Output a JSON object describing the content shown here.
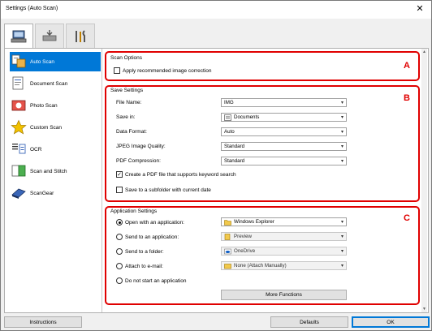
{
  "window": {
    "title": "Settings (Auto Scan)",
    "close_glyph": "✕"
  },
  "tabs": [
    {
      "icon": "computer-scan-icon"
    },
    {
      "icon": "scanner-tray-icon"
    },
    {
      "icon": "tools-icon"
    }
  ],
  "sidebar": {
    "items": [
      {
        "label": "Auto Scan",
        "icon": "auto-scan-icon",
        "active": true
      },
      {
        "label": "Document Scan",
        "icon": "document-scan-icon"
      },
      {
        "label": "Photo Scan",
        "icon": "photo-scan-icon"
      },
      {
        "label": "Custom Scan",
        "icon": "star-icon"
      },
      {
        "label": "OCR",
        "icon": "ocr-icon"
      },
      {
        "label": "Scan and Stitch",
        "icon": "stitch-icon"
      },
      {
        "label": "ScanGear",
        "icon": "scangear-icon"
      }
    ]
  },
  "scan_options": {
    "title": "Scan Options",
    "letter": "A",
    "apply_correction": {
      "label": "Apply recommended image correction",
      "checked": false
    }
  },
  "save_settings": {
    "title": "Save Settings",
    "letter": "B",
    "file_name": {
      "label": "File Name:",
      "value": "IMG"
    },
    "save_in": {
      "label": "Save in:",
      "value": "Documents"
    },
    "data_format": {
      "label": "Data Format:",
      "value": "Auto"
    },
    "jpeg_quality": {
      "label": "JPEG Image Quality:",
      "value": "Standard"
    },
    "pdf_compression": {
      "label": "PDF Compression:",
      "value": "Standard"
    },
    "keyword_search": {
      "label": "Create a PDF file that supports keyword search",
      "checked": true
    },
    "subfolder": {
      "label": "Save to a subfolder with current date",
      "checked": false
    }
  },
  "app_settings": {
    "title": "Application Settings",
    "letter": "C",
    "open_app": {
      "label": "Open with an application:",
      "value": "Windows Explorer",
      "selected": true
    },
    "send_app": {
      "label": "Send to an application:",
      "value": "Preview"
    },
    "send_folder": {
      "label": "Send to a folder:",
      "value": "OneDrive"
    },
    "attach_email": {
      "label": "Attach to e-mail:",
      "value": "None (Attach Manually)"
    },
    "do_not_start": {
      "label": "Do not start an application"
    },
    "more_functions": "More Functions"
  },
  "footer": {
    "instructions": "Instructions",
    "defaults": "Defaults",
    "ok": "OK"
  },
  "colors": {
    "accent": "#0078d7",
    "annotation": "#e00000"
  }
}
